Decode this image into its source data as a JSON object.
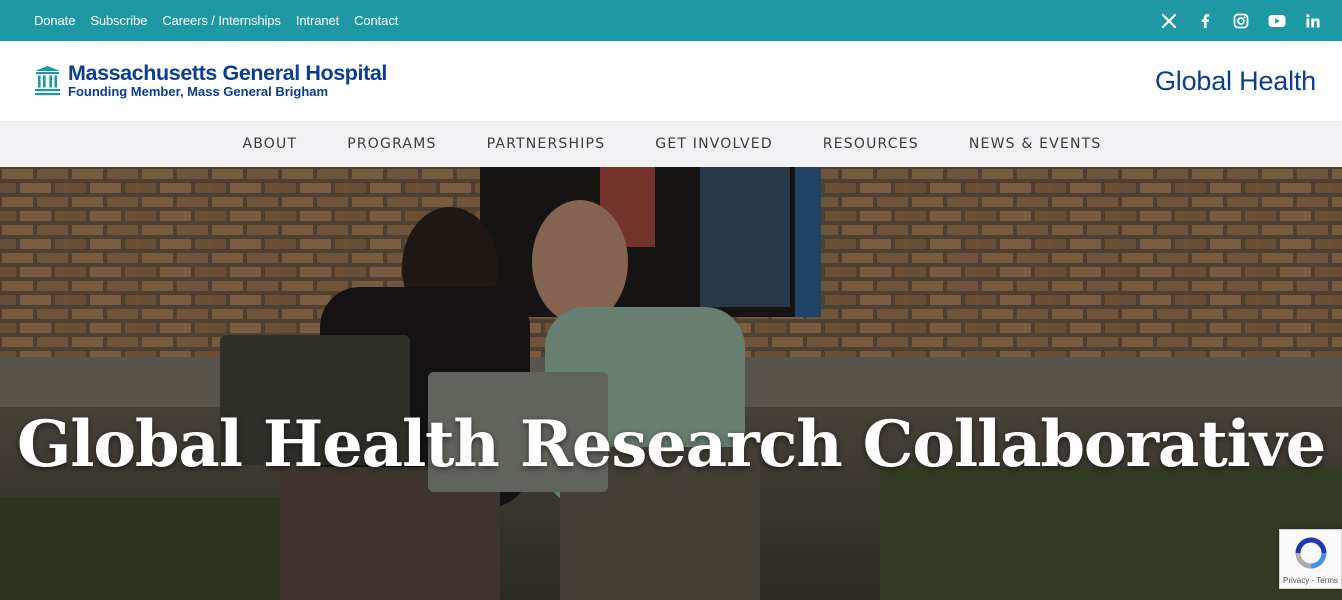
{
  "topbar": {
    "links": [
      "Donate",
      "Subscribe",
      "Careers / Internships",
      "Intranet",
      "Contact"
    ],
    "social": [
      "x-icon",
      "facebook-icon",
      "instagram-icon",
      "youtube-icon",
      "linkedin-icon"
    ],
    "background": "#1e98a5"
  },
  "brand": {
    "title": "Massachusetts General Hospital",
    "subtitle": "Founding Member, Mass General Brigham",
    "site_title": "Global Health",
    "color": "#0b3d91"
  },
  "nav": {
    "items": [
      "ABOUT",
      "PROGRAMS",
      "PARTNERSHIPS",
      "GET INVOLVED",
      "RESOURCES",
      "NEWS & EVENTS"
    ]
  },
  "hero": {
    "title": "Global Health Research Collaborative"
  },
  "recaptcha": {
    "text": "Privacy - Terms"
  }
}
